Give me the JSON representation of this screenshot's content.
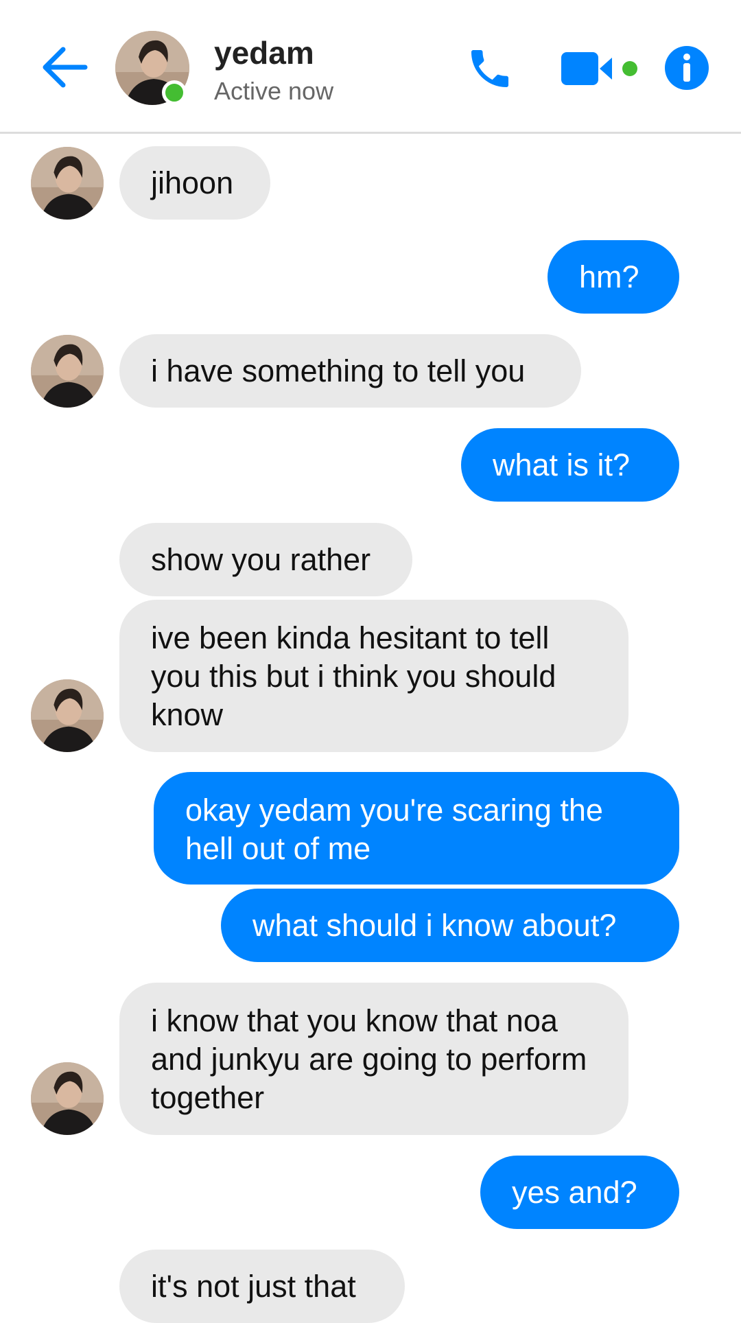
{
  "header": {
    "contact_name": "yedam",
    "status": "Active now",
    "icons": [
      "back-arrow-icon",
      "phone-icon",
      "video-camera-icon",
      "info-icon"
    ],
    "accent_color": "#0084ff",
    "online_color": "#44bd32"
  },
  "messages": [
    {
      "sender": "them",
      "text": "jihoon"
    },
    {
      "sender": "me",
      "text": "hm?"
    },
    {
      "sender": "them",
      "text": "i have something to tell you"
    },
    {
      "sender": "me",
      "text": "what is it?"
    },
    {
      "sender": "them",
      "text": "show you rather"
    },
    {
      "sender": "them",
      "text": "ive been kinda hesitant to tell you this but i think you should know"
    },
    {
      "sender": "me",
      "text": "okay yedam you're scaring the hell out of me"
    },
    {
      "sender": "me",
      "text": "what should i know about?"
    },
    {
      "sender": "them",
      "text": "i know that you know that noa and junkyu are going to perform together"
    },
    {
      "sender": "me",
      "text": "yes and?"
    },
    {
      "sender": "them",
      "text": "it's not just that"
    }
  ],
  "colors": {
    "incoming_bubble": "#e9e9e9",
    "outgoing_bubble": "#0084ff"
  }
}
